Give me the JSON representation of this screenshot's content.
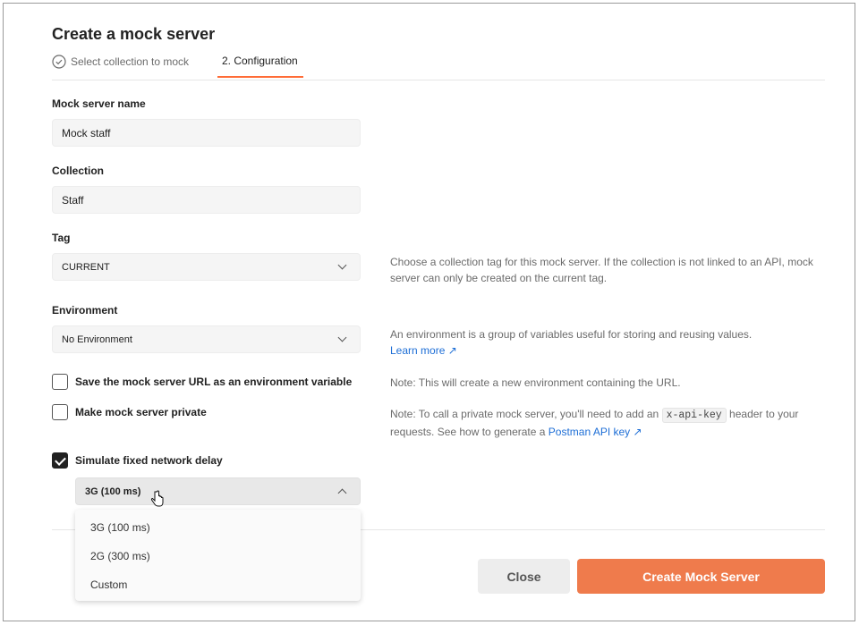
{
  "title": "Create a mock server",
  "steps": [
    {
      "label": "Select collection to mock",
      "state": "completed"
    },
    {
      "label": "2. Configuration",
      "state": "active"
    }
  ],
  "fields": {
    "name": {
      "label": "Mock server name",
      "value": "Mock staff"
    },
    "collection": {
      "label": "Collection",
      "value": "Staff"
    },
    "tag": {
      "label": "Tag",
      "value": "CURRENT",
      "help": "Choose a collection tag for this mock server. If the collection is not linked to an API, mock server can only be created on the current tag."
    },
    "environment": {
      "label": "Environment",
      "value": "No Environment",
      "help": "An environment is a group of variables useful for storing and reusing values.",
      "link": "Learn more ↗"
    }
  },
  "checkboxes": {
    "save_url": {
      "label": "Save the mock server URL as an environment variable",
      "checked": false,
      "note": "Note: This will create a new environment containing the URL."
    },
    "private": {
      "label": "Make mock server private",
      "checked": false,
      "note_pre": "Note: To call a private mock server, you'll need to add an",
      "note_code": "x-api-key",
      "note_post": "header to your requests. See how to generate a",
      "note_link": "Postman API key ↗"
    },
    "delay": {
      "label": "Simulate fixed network delay",
      "checked": true
    }
  },
  "delay_select": {
    "value": "3G (100 ms)",
    "options": [
      "3G (100 ms)",
      "2G (300 ms)",
      "Custom"
    ]
  },
  "buttons": {
    "close": "Close",
    "create": "Create Mock Server"
  },
  "colors": {
    "accent": "#ff6c37",
    "create_button": "#ef7b4c",
    "link": "#1d6ed6"
  }
}
